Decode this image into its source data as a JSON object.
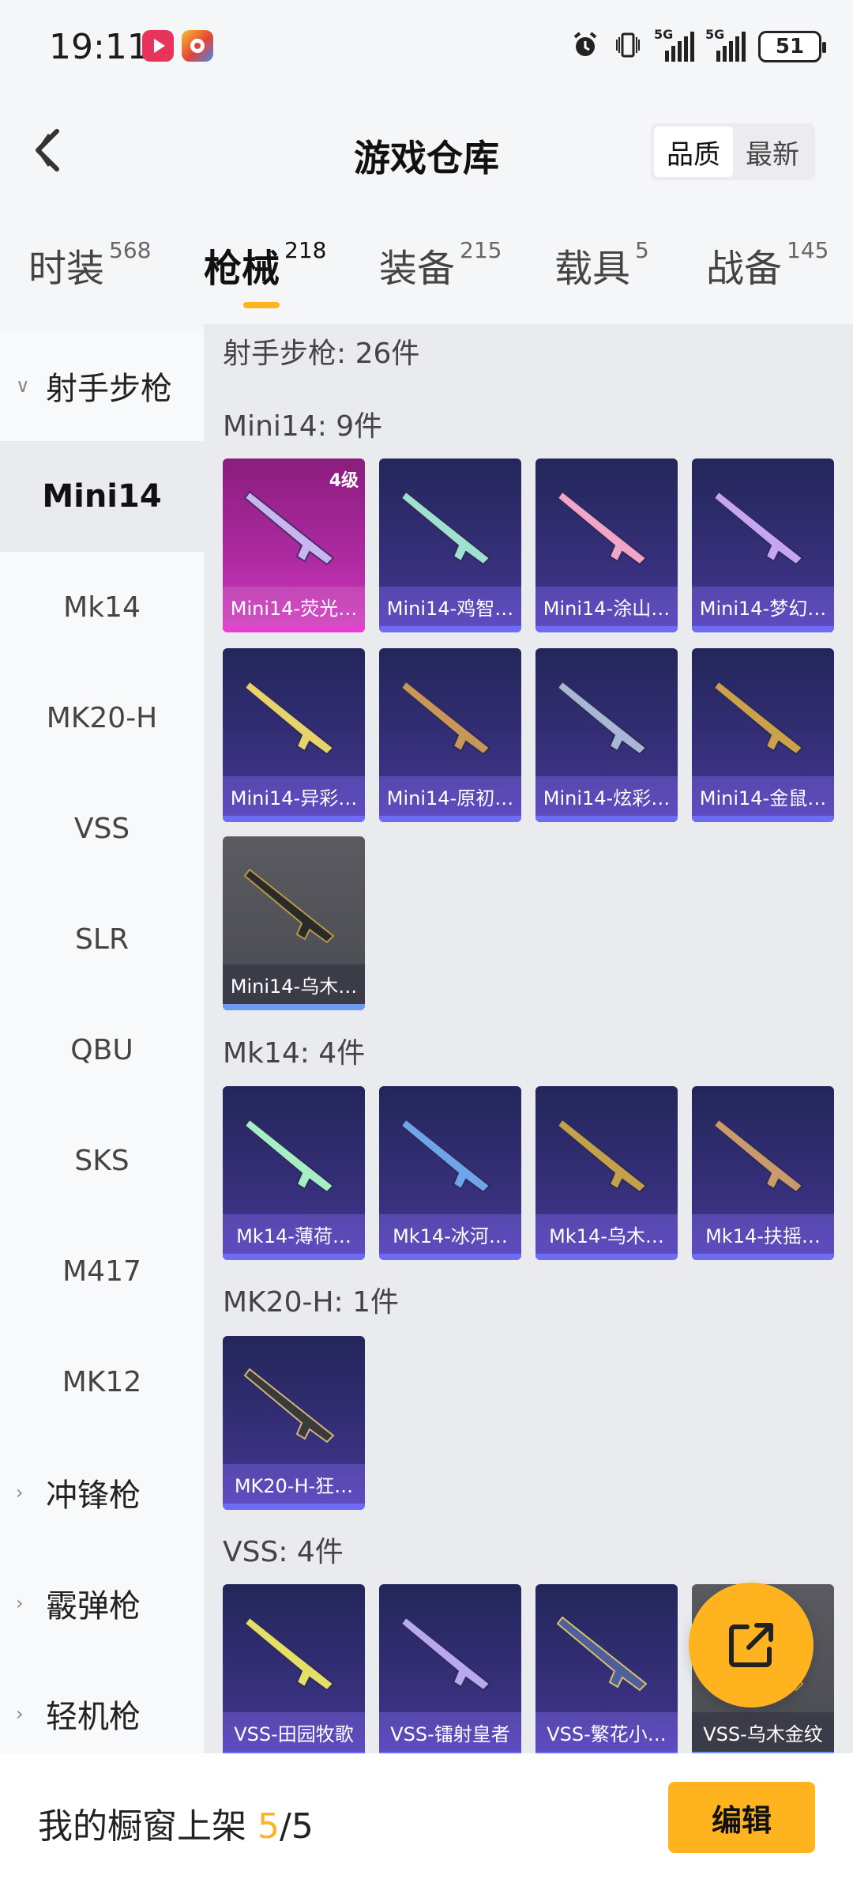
{
  "status": {
    "time": "19:11",
    "battery": "51",
    "net1": "5G",
    "net2": "5G"
  },
  "header": {
    "title": "游戏仓库",
    "sort_quality": "品质",
    "sort_newest": "最新"
  },
  "categories": [
    {
      "name": "时装",
      "count": "568"
    },
    {
      "name": "枪械",
      "count": "218"
    },
    {
      "name": "装备",
      "count": "215"
    },
    {
      "name": "载具",
      "count": "5"
    },
    {
      "name": "战备",
      "count": "145"
    }
  ],
  "sidebar": {
    "group_open": "射手步枪",
    "items": [
      "Mini14",
      "Mk14",
      "MK20-H",
      "VSS",
      "SLR",
      "QBU",
      "SKS",
      "M417",
      "MK12"
    ],
    "groups_closed": [
      "冲锋枪",
      "霰弹枪",
      "轻机枪"
    ]
  },
  "main": {
    "total": "射手步枪: 26件",
    "sections": [
      {
        "title": "Mini14: 9件",
        "items": [
          "Mini14-荧光…",
          "Mini14-鸡智…",
          "Mini14-涂山…",
          "Mini14-梦幻…",
          "Mini14-异彩…",
          "Mini14-原初…",
          "Mini14-炫彩…",
          "Mini14-金鼠…",
          "Mini14-乌木…"
        ],
        "first_level": "4级"
      },
      {
        "title": "Mk14: 4件",
        "items": [
          "Mk14-薄荷…",
          "Mk14-冰河…",
          "Mk14-乌木…",
          "Mk14-扶摇…"
        ]
      },
      {
        "title": "MK20-H: 1件",
        "items": [
          "MK20-H-狂…"
        ]
      },
      {
        "title": "VSS: 4件",
        "items": [
          "VSS-田园牧歌",
          "VSS-镭射皇者",
          "VSS-繁花小…",
          "VSS-乌木金纹"
        ]
      }
    ]
  },
  "bottom": {
    "shelf_label": "我的橱窗上架 ",
    "shelf_current": "5",
    "shelf_sep": "/",
    "shelf_total": "5",
    "edit_label": "编辑"
  },
  "colors": {
    "accent": "#ffb41f",
    "card_purple": "#3a3180",
    "card_pink": "#b02ba3"
  }
}
